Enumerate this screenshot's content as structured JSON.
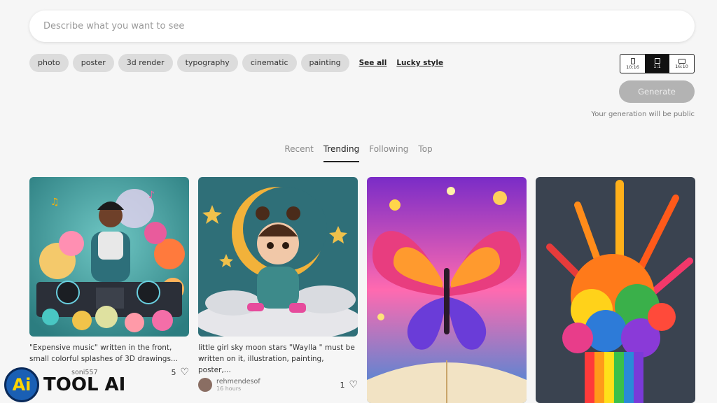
{
  "search": {
    "placeholder": "Describe what you want to see"
  },
  "styles": [
    "photo",
    "poster",
    "3d render",
    "typography",
    "cinematic",
    "painting"
  ],
  "links": {
    "see_all": "See all",
    "lucky": "Lucky style"
  },
  "ratios": [
    {
      "label": "10:16",
      "icon": "portrait-ratio-icon",
      "active": false
    },
    {
      "label": "1:1",
      "icon": "square-ratio-icon",
      "active": true
    },
    {
      "label": "16:10",
      "icon": "landscape-ratio-icon",
      "active": false
    }
  ],
  "generate": {
    "label": "Generate",
    "note": "Your generation will be public"
  },
  "tabs": [
    {
      "label": "Recent",
      "active": false
    },
    {
      "label": "Trending",
      "active": true
    },
    {
      "label": "Following",
      "active": false
    },
    {
      "label": "Top",
      "active": false
    }
  ],
  "cards": [
    {
      "caption_line1": "\"Expensive music\" written in the front,",
      "caption_line2": "small colorful splashes of 3D drawings...",
      "user": "soni557",
      "likes": "5"
    },
    {
      "caption_line1": "little girl sky moon stars \"Waylla \" must be",
      "caption_line2": "written on it, illustration, painting, poster,...",
      "user": "rehmendesof",
      "time": "16 hours",
      "likes": "1"
    }
  ],
  "logo": {
    "badge": "Ai",
    "text": "TOOL AI"
  },
  "colors": {
    "chip_bg": "#dcdcdc",
    "generate_disabled": "#b3b3b3",
    "active_tab": "#222222"
  }
}
